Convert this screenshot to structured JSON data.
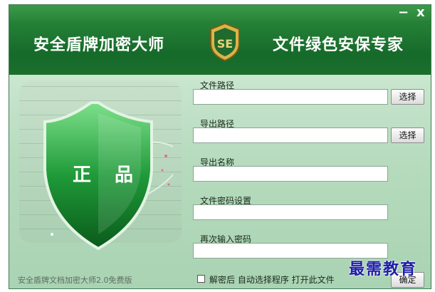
{
  "header": {
    "title_left": "安全盾牌加密大师",
    "title_right": "文件绿色安保专家",
    "logo_text": "SE",
    "minimize_icon": "−",
    "close_icon": "x"
  },
  "shield": {
    "text": "正 品"
  },
  "fields": [
    {
      "label": "文件路径",
      "value": "",
      "button": "选择"
    },
    {
      "label": "导出路径",
      "value": "",
      "button": "选择"
    },
    {
      "label": "导出名称",
      "value": ""
    },
    {
      "label": "文件密码设置",
      "value": ""
    },
    {
      "label": "再次输入密码",
      "value": ""
    }
  ],
  "footer": {
    "version": "安全盾牌文档加密大师2.0免费版",
    "checkbox_label": "解密后 自动选择程序 打开此文件",
    "checkbox_checked": false,
    "ok_button": "确定"
  },
  "watermark": "最需教育",
  "colors": {
    "header_green": "#227c34",
    "body_green": "#b6dbbd",
    "watermark_blue": "#1d1ea8"
  }
}
